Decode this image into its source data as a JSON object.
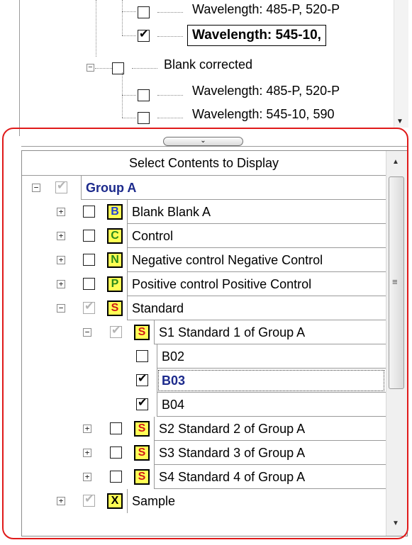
{
  "upper_tree": {
    "rows": [
      {
        "label": "Wavelength: 485-P, 520-P",
        "checked": false
      },
      {
        "label": "Wavelength: 545-10,",
        "checked": true,
        "selected": true
      },
      {
        "label": "Blank corrected",
        "checked": false
      },
      {
        "label": "Wavelength: 485-P, 520-P",
        "checked": false
      },
      {
        "label": "Wavelength: 545-10, 590",
        "checked": false
      }
    ]
  },
  "panel": {
    "header": "Select Contents to Display"
  },
  "tree": {
    "group": {
      "label": "Group A"
    },
    "blank": {
      "badge": "B",
      "label": "Blank Blank A",
      "color": "#1f3fd6"
    },
    "control": {
      "badge": "C",
      "label": "Control",
      "color": "#2a8a1a"
    },
    "negative": {
      "badge": "N",
      "label": "Negative control  Negative Control",
      "color": "#2a8a1a"
    },
    "positive": {
      "badge": "P",
      "label": "Positive control Positive Control",
      "color": "#2a8a1a"
    },
    "standard": {
      "badge": "S",
      "label": "Standard",
      "color": "#d01818"
    },
    "s1": {
      "badge": "S",
      "label": "S1 Standard 1 of Group A"
    },
    "b02": {
      "label": "B02",
      "checked": false
    },
    "b03": {
      "label": "B03",
      "checked": true
    },
    "b04": {
      "label": "B04",
      "checked": true
    },
    "s2": {
      "badge": "S",
      "label": "S2 Standard 2 of Group A"
    },
    "s3": {
      "badge": "S",
      "label": "S3 Standard 3 of Group A"
    },
    "s4": {
      "badge": "S",
      "label": "S4 Standard 4 of Group A"
    },
    "sample": {
      "badge": "X",
      "label": "Sample",
      "color": "#000000"
    }
  },
  "colors": {
    "outline": "#e01a1a",
    "badge_bg": "#ffff55",
    "group_text": "#1c2a8c"
  }
}
